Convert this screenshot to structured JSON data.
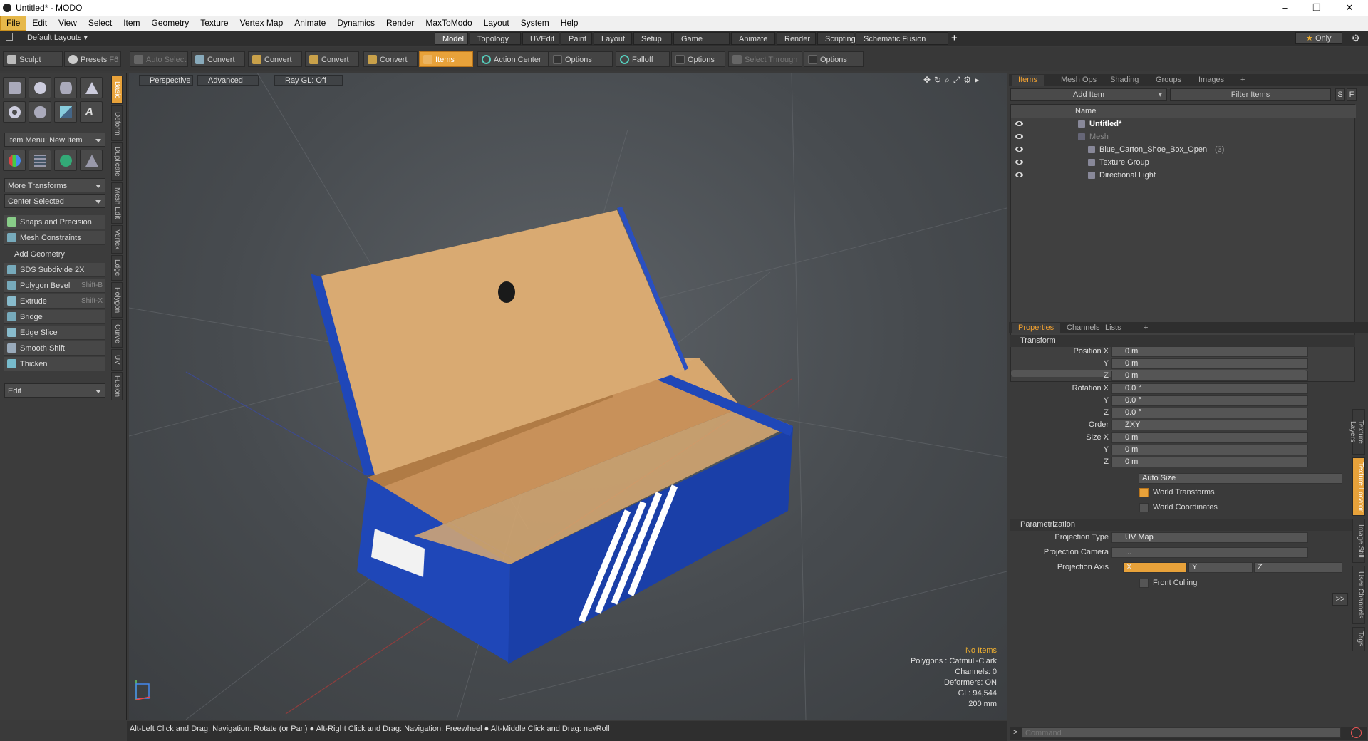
{
  "window": {
    "title": "Untitled* - MODO",
    "min": "–",
    "max": "❐",
    "close": "✕"
  },
  "menu": [
    "File",
    "Edit",
    "View",
    "Select",
    "Item",
    "Geometry",
    "Texture",
    "Vertex Map",
    "Animate",
    "Dynamics",
    "Render",
    "MaxToModo",
    "Layout",
    "System",
    "Help"
  ],
  "layoutbar": {
    "layouts_label": "Default Layouts ▾",
    "tabs": [
      "Model",
      "Topology",
      "UVEdit",
      "Paint",
      "Layout",
      "Setup",
      "Game Tools",
      "Animate",
      "Render",
      "Scripting",
      "Schematic Fusion"
    ],
    "add": "+",
    "only": "Only",
    "star": "★"
  },
  "toolbar": {
    "sculpt": "Sculpt",
    "presets": "Presets",
    "presets_key": "F6",
    "auto_select": "Auto Select",
    "convert": "Convert",
    "items": "Items",
    "action_center": "Action Center",
    "options": "Options",
    "falloff": "Falloff",
    "select_through": "Select Through"
  },
  "left": {
    "item_menu": "Item Menu: New Item",
    "more_transforms": "More Transforms",
    "center_selected": "Center Selected",
    "snaps": "Snaps and Precision",
    "mesh_constraints": "Mesh Constraints",
    "add_geometry": "Add Geometry",
    "tools": [
      {
        "label": "SDS Subdivide 2X",
        "key": ""
      },
      {
        "label": "Polygon Bevel",
        "key": "Shift-B"
      },
      {
        "label": "Extrude",
        "key": "Shift-X"
      },
      {
        "label": "Bridge",
        "key": ""
      },
      {
        "label": "Edge Slice",
        "key": ""
      },
      {
        "label": "Smooth Shift",
        "key": ""
      },
      {
        "label": "Thicken",
        "key": ""
      }
    ],
    "edit": "Edit",
    "vtabs": [
      "Basic",
      "Deform",
      "Duplicate",
      "Mesh Edit",
      "Vertex",
      "Edge",
      "Polygon",
      "Curve",
      "UV",
      "Fusion"
    ]
  },
  "viewport": {
    "tabs": [
      "Perspective",
      "Advanced",
      "Ray GL: Off"
    ],
    "stats": {
      "no_items": "No Items",
      "polygons": "Polygons : Catmull-Clark",
      "channels": "Channels: 0",
      "deformers": "Deformers: ON",
      "gl": "GL: 94,544",
      "scale": "200 mm"
    }
  },
  "status": "Alt-Left Click and Drag: Navigation: Rotate (or Pan) ● Alt-Right Click and Drag: Navigation: Freewheel ● Alt-Middle Click and Drag: navRoll",
  "items_panel": {
    "tabs": [
      "Items",
      "Mesh Ops",
      "Shading",
      "Groups",
      "Images"
    ],
    "add_item": "Add Item",
    "filter": "Filter Items",
    "s": "S",
    "f": "F",
    "name_col": "Name",
    "rows": [
      {
        "label": "Untitled*",
        "extra": ""
      },
      {
        "label": "Mesh",
        "extra": ""
      },
      {
        "label": "Blue_Carton_Shoe_Box_Open",
        "extra": "(3)"
      },
      {
        "label": "Texture Group",
        "extra": ""
      },
      {
        "label": "Directional Light",
        "extra": ""
      }
    ]
  },
  "props_panel": {
    "tabs": [
      "Properties",
      "Channels",
      "Lists"
    ],
    "transform": "Transform",
    "position_x": "Position X",
    "rotation_x": "Rotation X",
    "size_x": "Size X",
    "y": "Y",
    "z": "Z",
    "zero_m": "0 m",
    "zero_deg": "0.0 °",
    "order": "Order",
    "order_val": "ZXY",
    "auto_size": "Auto Size",
    "world_transforms": "World Transforms",
    "world_coordinates": "World Coordinates",
    "parametrization": "Parametrization",
    "projection_type": "Projection Type",
    "projection_type_val": "UV Map",
    "projection_camera": "Projection Camera",
    "projection_camera_val": "...",
    "projection_axis": "Projection Axis",
    "axis_x": "X",
    "axis_y": "Y",
    "axis_z": "Z",
    "front_culling": "Front Culling",
    "more": ">>",
    "vtabs": [
      "Texture Layers",
      "Texture Locator",
      "Image Still",
      "User Channels",
      "Tags"
    ]
  },
  "command": {
    "placeholder": "Command",
    "prompt": ">"
  },
  "colors": {
    "accent": "#e8a23a",
    "box_blue": "#1f47b8",
    "cardboard": "#d9aa72"
  }
}
